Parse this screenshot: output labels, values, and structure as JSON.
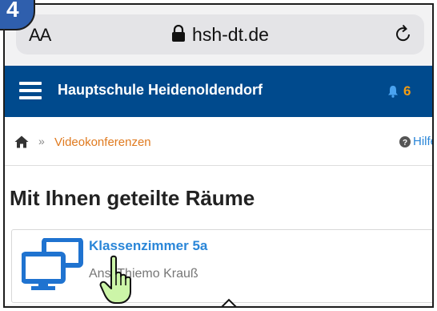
{
  "browser": {
    "aa_label": "AA",
    "domain": "hsh-dt.de"
  },
  "site": {
    "title": "Hauptschule Heidenoldendorf",
    "notification_count": "6"
  },
  "breadcrumb": {
    "separator": "»",
    "current": "Videokonferenzen",
    "help": "Hilfe"
  },
  "page": {
    "title": "Mit Ihnen geteilte Räume"
  },
  "rooms": [
    {
      "name": "Klassenzimmer 5a",
      "owner": "Ansi Thiemo Krauß"
    }
  ],
  "tutorial": {
    "step": "4"
  },
  "colors": {
    "header_bg": "#004a8d",
    "link_blue": "#2a86d8",
    "breadcrumb_orange": "#e07a1f",
    "badge_blue": "#2f5fad",
    "cursor_green": "#ccf5a8"
  }
}
